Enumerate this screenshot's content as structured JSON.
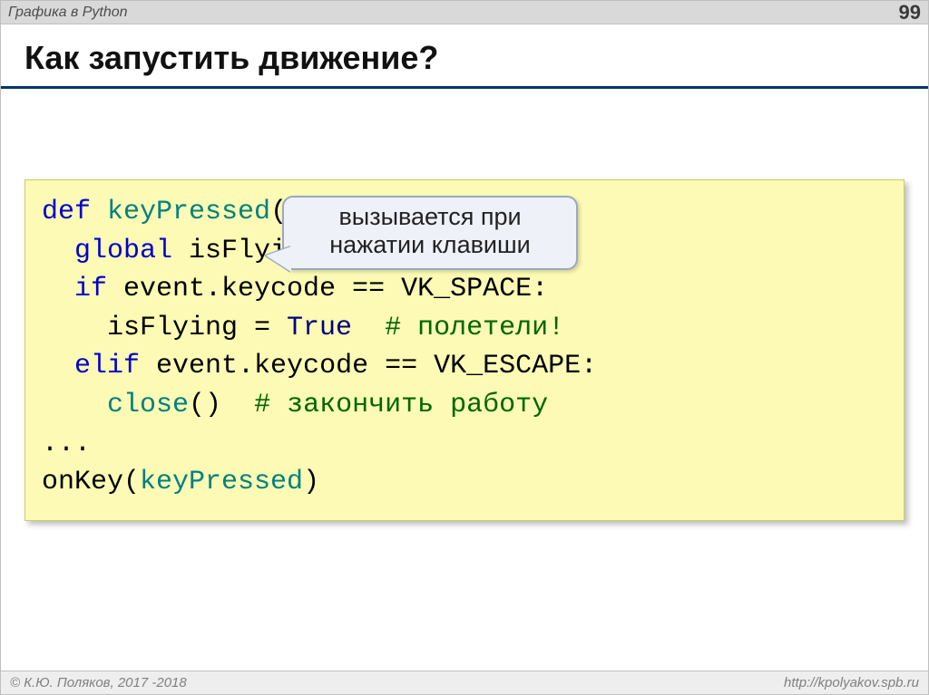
{
  "header": {
    "left": "Графика в Python",
    "page_number": "99"
  },
  "title": "Как запустить движение?",
  "callout": {
    "line1": "вызывается при",
    "line2": "нажатии клавиши"
  },
  "code": {
    "l1_def": "def",
    "l1_name": " keyPressed",
    "l1_rest": "(event):",
    "l2_global": "  global",
    "l2_rest": " isFlying",
    "l3_if": "  if",
    "l3_rest": " event.keycode == VK_SPACE:",
    "l4_lhs": "    isFlying = ",
    "l4_true": "True",
    "l4_pad": "  ",
    "l4_comment": "# полетели!",
    "l5_elif": "  elif",
    "l5_rest": " event.keycode == VK_ESCAPE:",
    "l6_pad": "    ",
    "l6_close": "close",
    "l6_paren": "()",
    "l6_pad2": "  ",
    "l6_comment": "# закончить работу",
    "l7": "...",
    "l8_onkey": "onKey",
    "l8_paren_open": "(",
    "l8_arg": "keyPressed",
    "l8_paren_close": ")"
  },
  "footer": {
    "left": "© К.Ю. Поляков, 2017 -2018",
    "right": "http://kpolyakov.spb.ru"
  }
}
